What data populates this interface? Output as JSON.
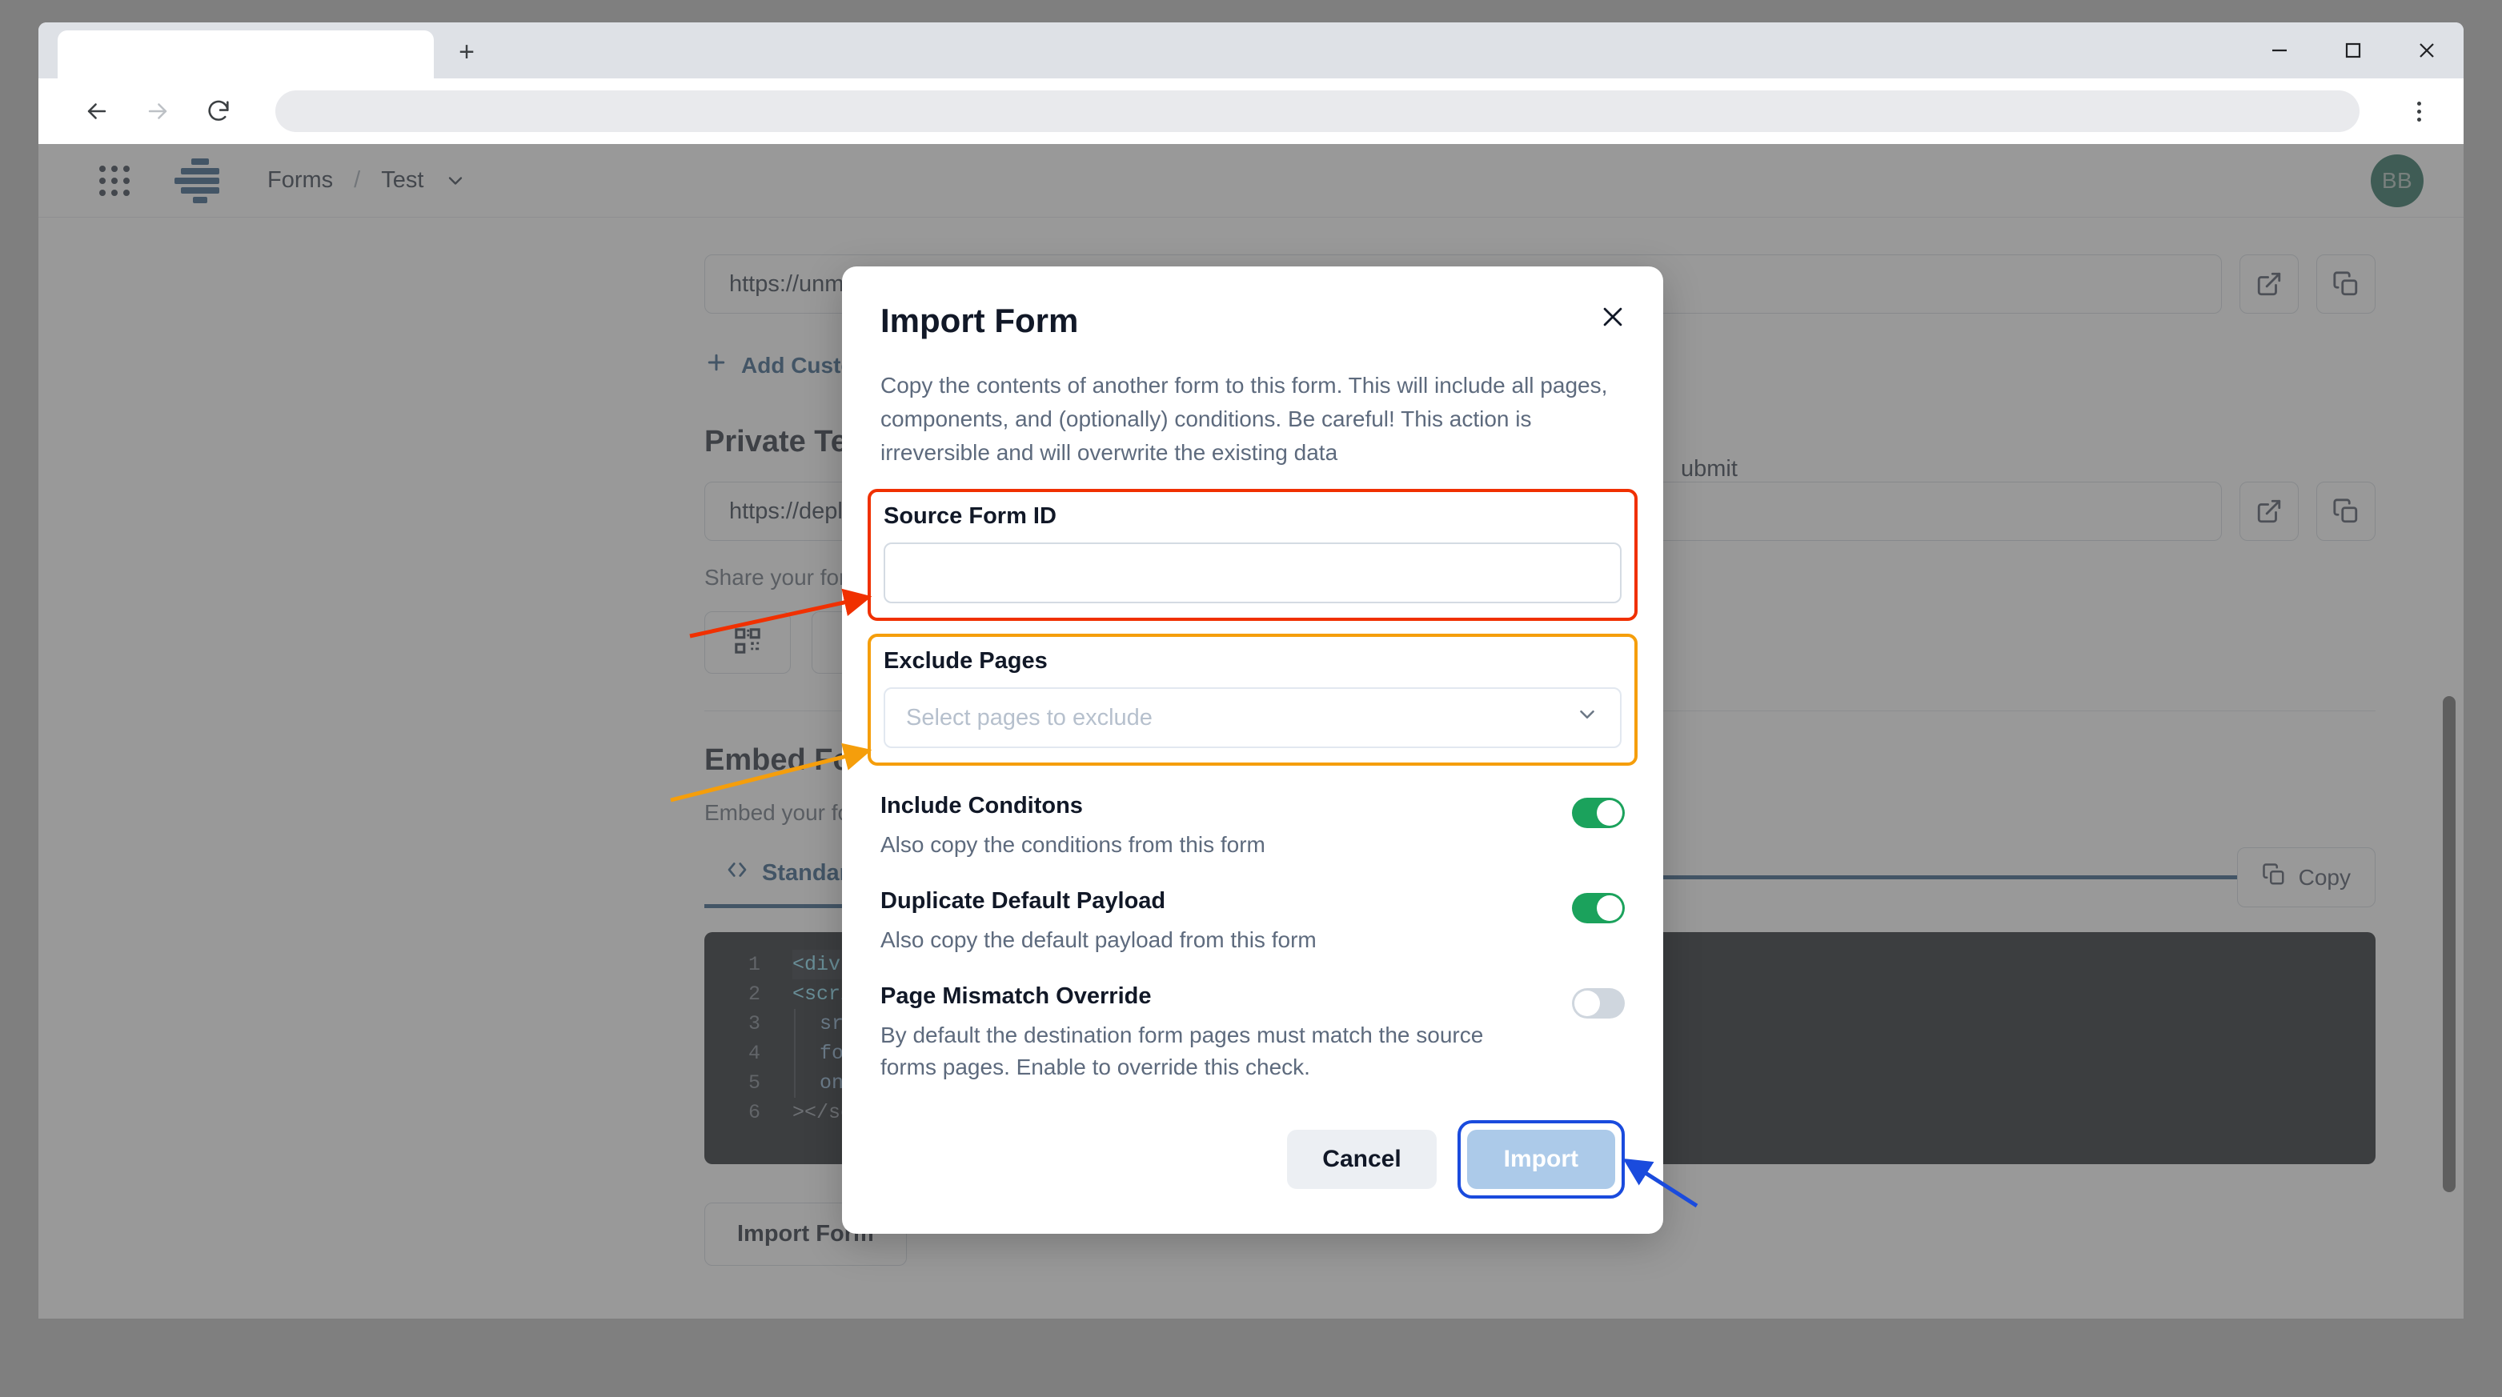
{
  "browser": {
    "tab_title": "",
    "new_tab_label": "+",
    "address_value": "",
    "back_icon": "back-arrow-icon",
    "forward_icon": "forward-arrow-icon",
    "reload_icon": "reload-icon",
    "menu_icon": "kebab-menu-icon",
    "minimize_label": "—",
    "maximize_label": "□",
    "close_label": "✕"
  },
  "app_header": {
    "apps_grid_icon": "apps-grid-icon",
    "logo_icon": "forms-logo-icon",
    "breadcrumb": {
      "root": "Forms",
      "separator": "/",
      "current": "Test",
      "chevron": "chevron-down-icon"
    },
    "avatar_initials": "BB"
  },
  "page": {
    "public_url": "https://unmar",
    "add_custom_label": "Add Custom",
    "plus_icon": "plus-icon",
    "private_section_title": "Private Test L",
    "private_url": "https://deploy",
    "private_url_tail": "ubmit",
    "share_caption": "Share your form",
    "qr_icon": "qr-code-icon",
    "external_link_icon": "external-link-icon",
    "copy_icon": "copy-icon",
    "embed_title": "Embed Form",
    "embed_subtitle": "Embed your form",
    "embed_tab_label": "Standard",
    "embed_tab_icon": "code-brackets-icon",
    "copy_button_label": "Copy",
    "import_form_button": "Import Form",
    "code_lines": [
      {
        "n": "1",
        "text": "<div id",
        "highlighted": true
      },
      {
        "n": "2",
        "text": "<script",
        "highlighted": false
      },
      {
        "n": "3",
        "text": "  src=\"",
        "highlighted": false
      },
      {
        "n": "4",
        "text": "  form-",
        "highlighted": false
      },
      {
        "n": "5",
        "text": "  onloa",
        "highlighted": false
      },
      {
        "n": "6",
        "text": "></scri",
        "highlighted": false
      }
    ]
  },
  "modal": {
    "title": "Import Form",
    "close_icon": "close-icon",
    "description": "Copy the contents of another form to this form. This will include all pages, components, and (optionally) conditions. Be careful! This action is irreversible and will overwrite the existing data",
    "source_form_id": {
      "label": "Source Form ID",
      "value": "",
      "placeholder": ""
    },
    "exclude_pages": {
      "label": "Exclude Pages",
      "value": "",
      "placeholder": "Select pages to exclude",
      "chevron": "chevron-down-icon"
    },
    "toggles": [
      {
        "label": "Include Conditons",
        "description": "Also copy the conditions from this form",
        "on": true
      },
      {
        "label": "Duplicate Default Payload",
        "description": "Also copy the default payload from this form",
        "on": true
      },
      {
        "label": "Page Mismatch Override",
        "description": "By default the destination form pages must match the source forms pages. Enable to override this check.",
        "on": false
      }
    ],
    "cancel_label": "Cancel",
    "import_label": "Import"
  },
  "annotations": {
    "source_field_highlight_color": "#f03000",
    "exclude_field_highlight_color": "#f59e0b",
    "import_button_highlight_color": "#1a4bdd"
  }
}
